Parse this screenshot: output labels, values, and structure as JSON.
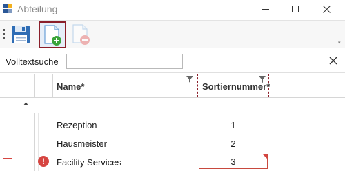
{
  "window": {
    "title": "Abteilung",
    "title_color": "#8a8a8a"
  },
  "toolbar": {
    "buttons": [
      {
        "name": "save",
        "icon": "floppy-disk-icon"
      },
      {
        "name": "new",
        "icon": "new-document-icon",
        "state": "selected"
      },
      {
        "name": "delete",
        "icon": "delete-document-icon",
        "state": "disabled"
      }
    ],
    "highlight_color": "#8b1f2a"
  },
  "search": {
    "label": "Volltextsuche",
    "value": ""
  },
  "grid": {
    "columns": [
      {
        "key": "name",
        "label": "Name*"
      },
      {
        "key": "sort",
        "label": "Sortiernummer*"
      }
    ],
    "rows": [
      {
        "name": "Rezeption",
        "sort": "1"
      },
      {
        "name": "Hausmeister",
        "sort": "2"
      },
      {
        "name": "Facility Services",
        "sort": "3",
        "state": "error"
      }
    ],
    "error_color": "#d64541"
  }
}
